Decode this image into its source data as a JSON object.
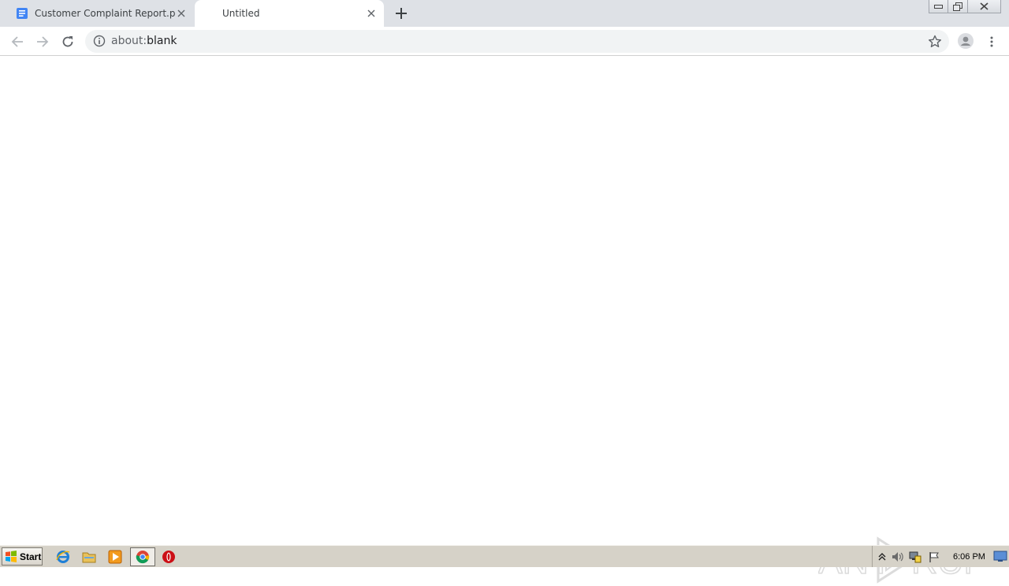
{
  "browser": {
    "tabs": [
      {
        "title": "Customer Complaint Report.pdf",
        "favicon": "google-docs-icon",
        "active": false
      },
      {
        "title": "Untitled",
        "favicon": "",
        "active": true
      }
    ],
    "address": {
      "prefix": "about:",
      "suffix": "blank"
    }
  },
  "watermark": {
    "text": "ANY RUN"
  },
  "taskbar": {
    "start_label": "Start",
    "pinned": [
      "internet-explorer-icon",
      "file-explorer-icon",
      "media-player-icon",
      "chrome-icon",
      "opera-icon"
    ],
    "clock": "6:06 PM"
  },
  "colors": {
    "tabstrip": "#dee1e6",
    "omnibox": "#f1f3f4",
    "taskbar": "#d6d2c8",
    "docs_blue": "#4285f4"
  }
}
